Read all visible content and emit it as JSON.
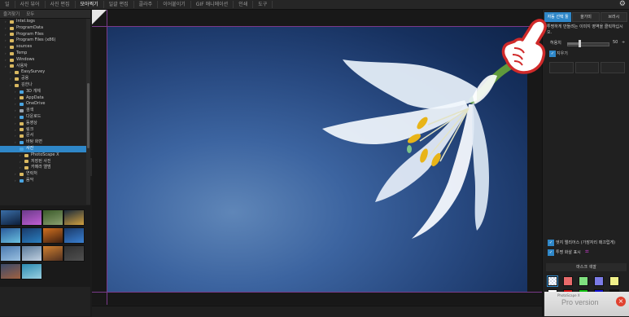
{
  "menubar": {
    "items": [
      "일",
      "사진 뷰어",
      "사진 편집",
      "모아찍기",
      "일괄 편집",
      "콜라주",
      "이어붙이기",
      "GIF 애니메이션",
      "인쇄",
      "도구"
    ],
    "active_index": 3
  },
  "left_panel": {
    "tabs": [
      "즐겨찾기",
      "모두"
    ],
    "tree": [
      {
        "label": "Intel.logs",
        "depth": 1,
        "icon": "folder"
      },
      {
        "label": "ProgramData",
        "depth": 1,
        "icon": "folder"
      },
      {
        "label": "Program Files",
        "depth": 1,
        "icon": "folder"
      },
      {
        "label": "Program Files (x86)",
        "depth": 1,
        "icon": "folder"
      },
      {
        "label": "sources",
        "depth": 1,
        "icon": "folder"
      },
      {
        "label": "Temp",
        "depth": 1,
        "icon": "folder"
      },
      {
        "label": "Windows",
        "depth": 1,
        "icon": "folder"
      },
      {
        "label": "사용자",
        "depth": 1,
        "icon": "folder"
      },
      {
        "label": "EasySurvey",
        "depth": 2,
        "icon": "folder"
      },
      {
        "label": "공용",
        "depth": 2,
        "icon": "folder"
      },
      {
        "label": "김한나",
        "depth": 2,
        "icon": "folder"
      },
      {
        "label": "3D 개체",
        "depth": 3,
        "icon": "folder-blue"
      },
      {
        "label": "AppData",
        "depth": 3,
        "icon": "folder"
      },
      {
        "label": "OneDrive",
        "depth": 3,
        "icon": "folder-blue"
      },
      {
        "label": "검색",
        "depth": 3,
        "icon": "folder-gray"
      },
      {
        "label": "다운로드",
        "depth": 3,
        "icon": "folder-blue"
      },
      {
        "label": "동영상",
        "depth": 3,
        "icon": "folder"
      },
      {
        "label": "링크",
        "depth": 3,
        "icon": "folder"
      },
      {
        "label": "문서",
        "depth": 3,
        "icon": "folder"
      },
      {
        "label": "바탕 화면",
        "depth": 3,
        "icon": "folder-blue"
      },
      {
        "label": "사진",
        "depth": 3,
        "icon": "folder-blue",
        "selected": true
      },
      {
        "label": "PhotoScape X",
        "depth": 4,
        "icon": "folder"
      },
      {
        "label": "저장된 사진",
        "depth": 4,
        "icon": "folder"
      },
      {
        "label": "카메라 앨범",
        "depth": 4,
        "icon": "folder"
      },
      {
        "label": "연락처",
        "depth": 3,
        "icon": "folder"
      },
      {
        "label": "음악",
        "depth": 3,
        "icon": "folder-blue"
      }
    ]
  },
  "right_panel": {
    "tabs": [
      "자동 선택 툴",
      "올가미",
      "브러시"
    ],
    "active_tab": 0,
    "description": "투명하게 만들려는 이미지 영역을 클릭하십시오.",
    "thickness_label": "허용치",
    "thickness_value": "50",
    "thickness_fraction": 0.3,
    "stepper": "÷",
    "eraser_label": "지우기",
    "disabled_buttons": [
      "",
      "",
      ""
    ],
    "edge_label": "엣지 앨리어스 (가장자리 매끄럽게)",
    "transparent_label": "투명 화살 표시",
    "mask_title": "마스크 색깔",
    "swatch_colors": [
      "#ffffff",
      "#e86a6a",
      "#7fe07f",
      "#7b7be6",
      "#f0f08a",
      "#ffffff",
      "#d01010",
      "#10c010",
      "#1010d0",
      "#111111"
    ]
  },
  "promo": {
    "small": "PhotoScape X",
    "label": "Pro version",
    "close": "×"
  }
}
